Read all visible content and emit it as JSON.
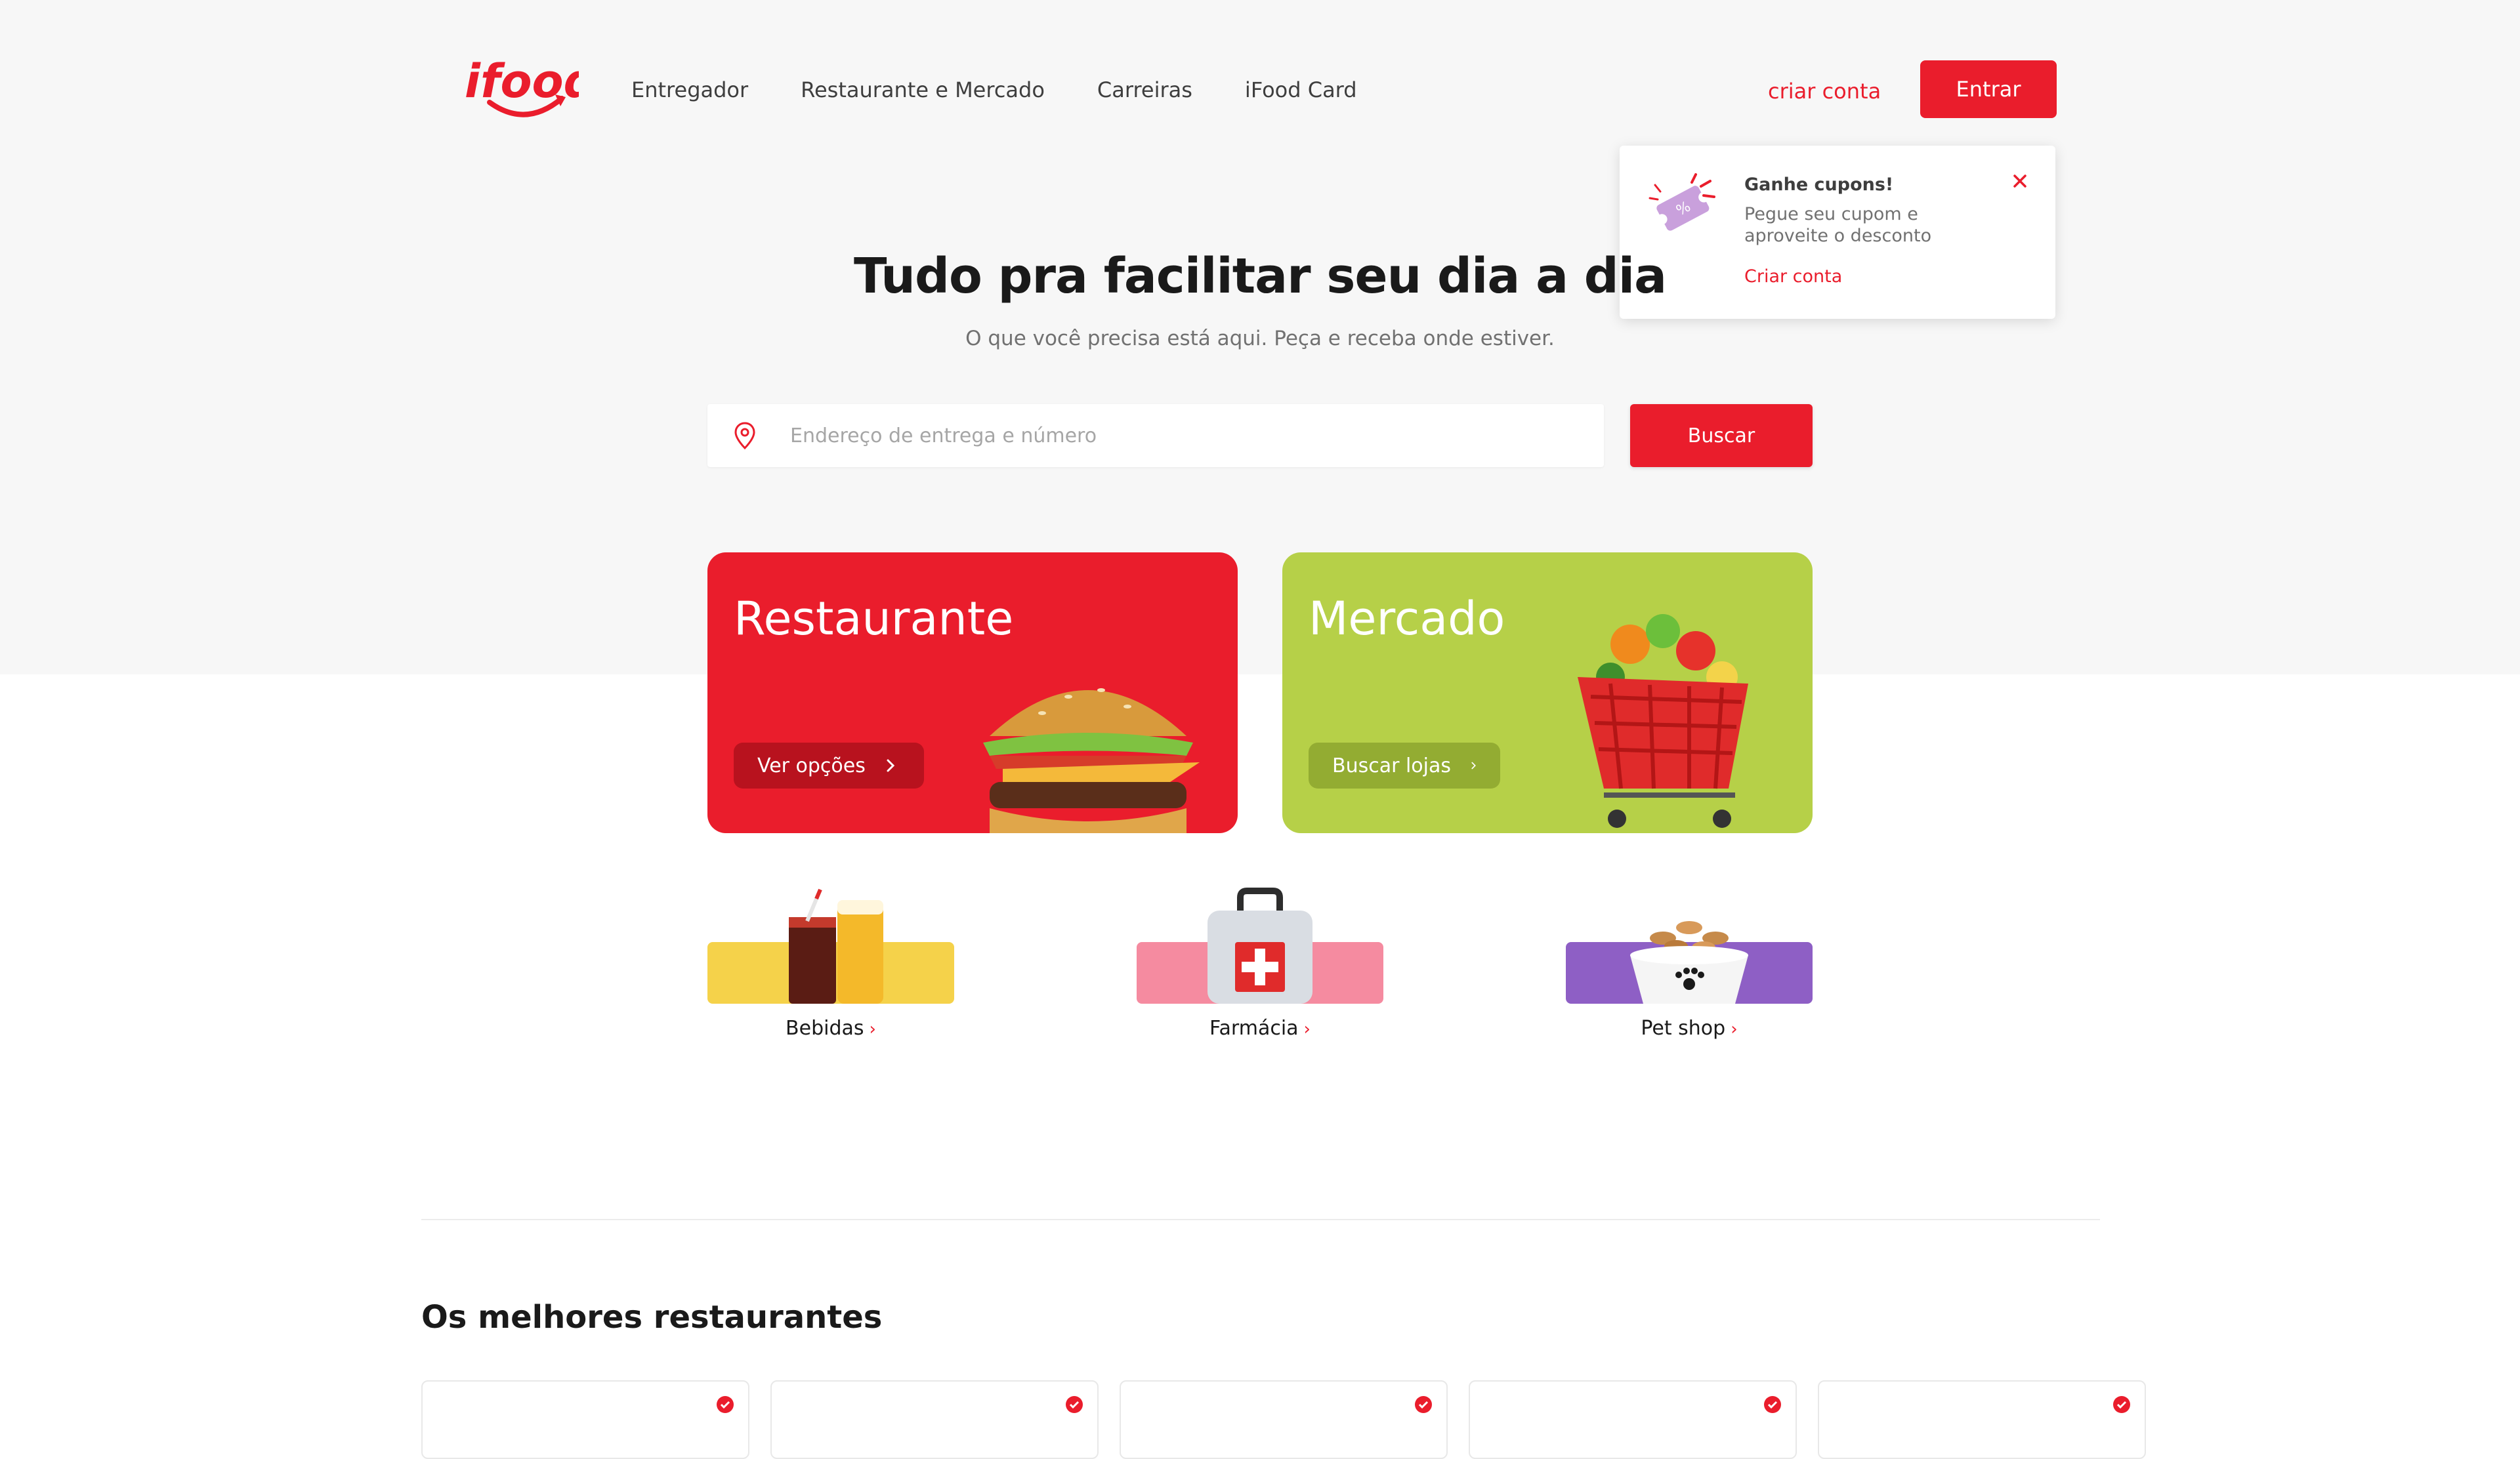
{
  "header": {
    "logo_text": "ifood",
    "nav": [
      "Entregador",
      "Restaurante e Mercado",
      "Carreiras",
      "iFood Card"
    ],
    "create_account": "criar conta",
    "login": "Entrar"
  },
  "popover": {
    "title": "Ganhe cupons!",
    "subtitle": "Pegue seu cupom e aproveite o desconto",
    "cta": "Criar conta"
  },
  "hero": {
    "title": "Tudo pra facilitar seu dia a dia",
    "subtitle": "O que você precisa está aqui. Peça e receba onde estiver.",
    "search_placeholder": "Endereço de entrega e número",
    "search_value": "",
    "search_button": "Buscar"
  },
  "cards": {
    "restaurante": {
      "title": "Restaurante",
      "button": "Ver opções"
    },
    "mercado": {
      "title": "Mercado",
      "button": "Buscar lojas"
    }
  },
  "categories": [
    {
      "label": "Bebidas",
      "icon": "drinks-icon"
    },
    {
      "label": "Farmácia",
      "icon": "first-aid-kit-icon"
    },
    {
      "label": "Pet shop",
      "icon": "pet-food-bowl-icon"
    }
  ],
  "sections": {
    "best_restaurants": "Os melhores restaurantes"
  },
  "colors": {
    "brand": "#ea1d2c",
    "market": "#b6d048",
    "drinks": "#f5d24a",
    "pharmacy": "#f58ba0",
    "petshop": "#8e5fc5"
  }
}
